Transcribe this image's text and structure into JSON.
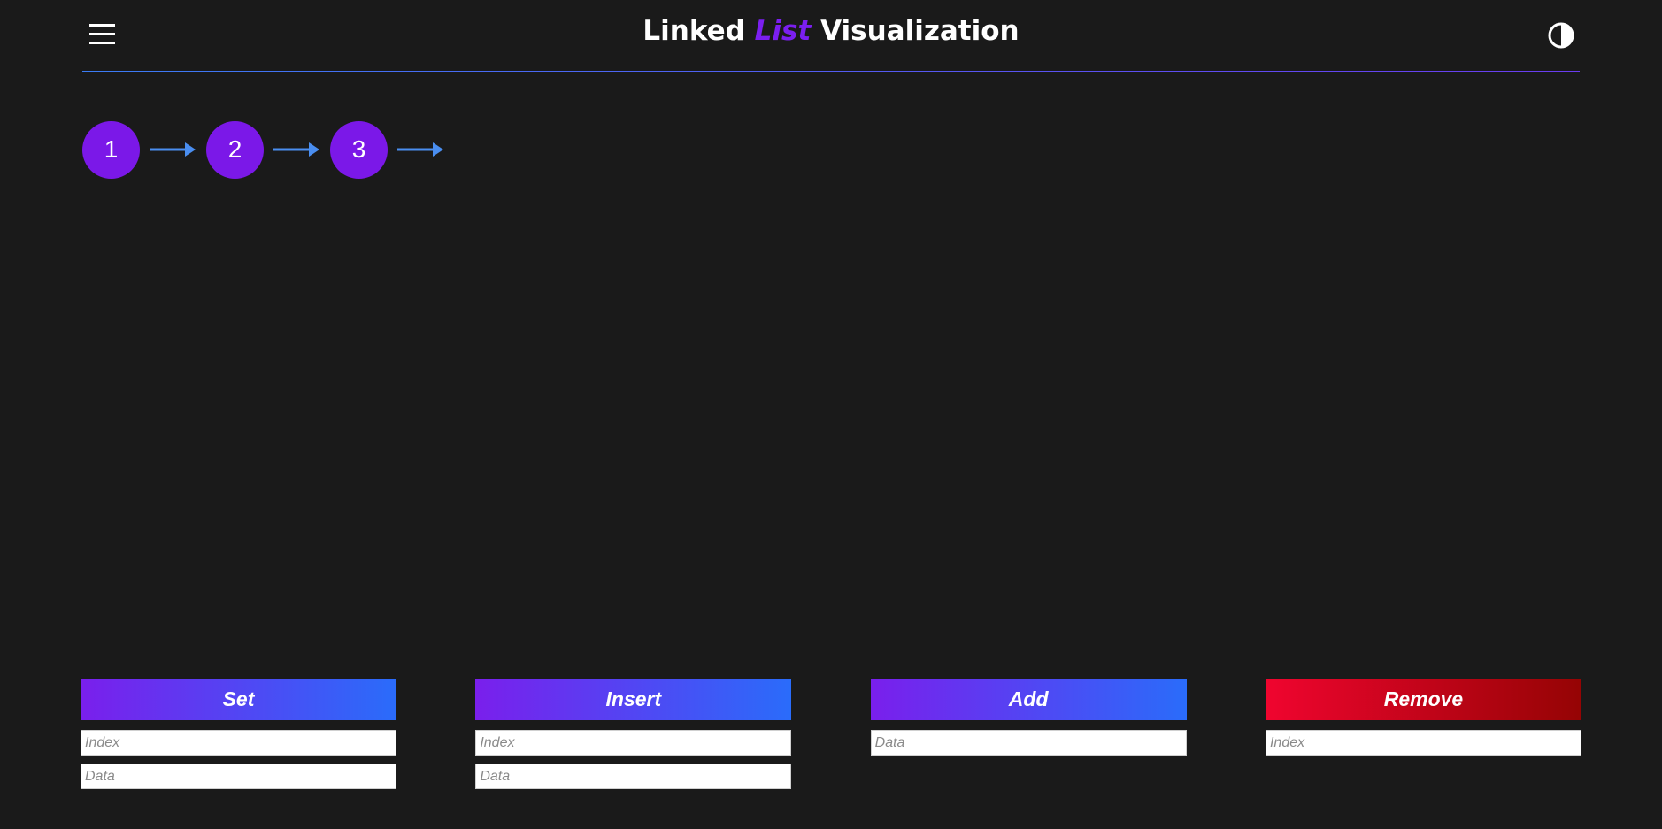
{
  "header": {
    "title_prefix": "Linked",
    "title_accent": "List",
    "title_suffix": "Visualization",
    "menu_icon": "hamburger-icon",
    "theme_icon": "contrast-icon"
  },
  "colors": {
    "background": "#1a1a1a",
    "node": "#7b18e8",
    "arrow": "#4a8ef0",
    "accent": "#7b1ff0",
    "primary_gradient": [
      "#7a1fec",
      "#2a6cfa"
    ],
    "danger_gradient": [
      "#f0052f",
      "#950404"
    ]
  },
  "list": {
    "nodes": [
      "1",
      "2",
      "3"
    ]
  },
  "controls": {
    "set": {
      "label": "Set",
      "index_placeholder": "Index",
      "data_placeholder": "Data"
    },
    "insert": {
      "label": "Insert",
      "index_placeholder": "Index",
      "data_placeholder": "Data"
    },
    "add": {
      "label": "Add",
      "data_placeholder": "Data"
    },
    "remove": {
      "label": "Remove",
      "index_placeholder": "Index"
    }
  }
}
